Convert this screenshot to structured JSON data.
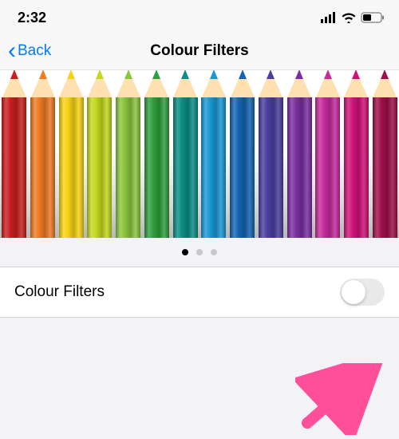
{
  "status": {
    "time": "2:32"
  },
  "nav": {
    "back_label": "Back",
    "title": "Colour Filters"
  },
  "pencil_colors": [
    "#c8201f",
    "#ee7b24",
    "#f6d312",
    "#c4d91c",
    "#8bc53f",
    "#2f9e3d",
    "#0b8e84",
    "#1898d4",
    "#1464b3",
    "#4a3ea1",
    "#7a2fa0",
    "#c52b9c",
    "#d1117a",
    "#a00f4a"
  ],
  "carousel": {
    "page_count": 3,
    "active_index": 0
  },
  "setting": {
    "label": "Colour Filters",
    "on": false
  },
  "annotation": {
    "arrow_color": "#ff4f9a"
  }
}
